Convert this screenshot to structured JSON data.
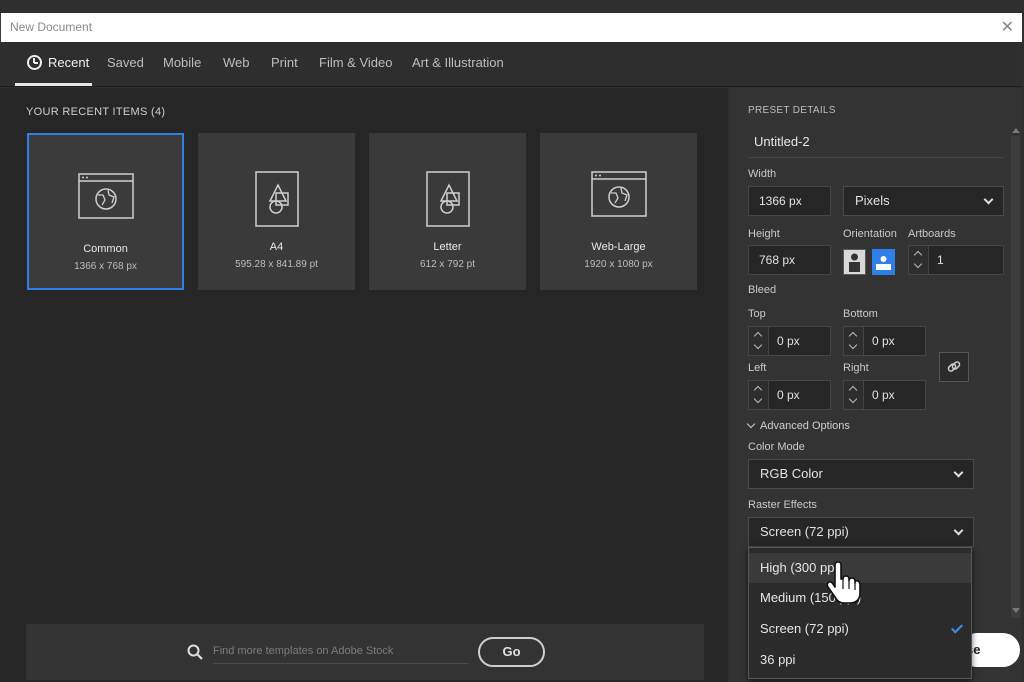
{
  "window": {
    "title": "New Document",
    "close_glyph": "✕"
  },
  "tabs": [
    {
      "label": "Recent",
      "active": true,
      "icon": "clock-icon"
    },
    {
      "label": "Saved"
    },
    {
      "label": "Mobile"
    },
    {
      "label": "Web"
    },
    {
      "label": "Print"
    },
    {
      "label": "Film & Video"
    },
    {
      "label": "Art & Illustration"
    }
  ],
  "recent": {
    "heading": "YOUR RECENT ITEMS",
    "count": "(4)",
    "items": [
      {
        "name": "Common",
        "dimensions": "1366 x 768 px",
        "icon": "web-globe-icon",
        "selected": true
      },
      {
        "name": "A4",
        "dimensions": "595.28 x 841.89 pt",
        "icon": "print-doc-icon"
      },
      {
        "name": "Letter",
        "dimensions": "612 x 792 pt",
        "icon": "print-doc-icon"
      },
      {
        "name": "Web-Large",
        "dimensions": "1920 x 1080 px",
        "icon": "web-globe-icon"
      }
    ]
  },
  "search": {
    "placeholder": "Find more templates on Adobe Stock",
    "go_label": "Go"
  },
  "preset": {
    "heading": "PRESET DETAILS",
    "doc_name": "Untitled-2",
    "width_label": "Width",
    "width_value": "1366 px",
    "units": "Pixels",
    "height_label": "Height",
    "height_value": "768 px",
    "orientation_label": "Orientation",
    "artboards_label": "Artboards",
    "artboards_value": "1",
    "bleed_label": "Bleed",
    "top_label": "Top",
    "top_value": "0 px",
    "bottom_label": "Bottom",
    "bottom_value": "0 px",
    "left_label": "Left",
    "left_value": "0 px",
    "right_label": "Right",
    "right_value": "0 px",
    "advanced_label": "Advanced Options",
    "color_mode_label": "Color Mode",
    "color_mode_value": "RGB Color",
    "raster_label": "Raster Effects",
    "raster_value": "Screen (72 ppi)",
    "create_label": "se"
  },
  "raster_menu": {
    "options": [
      {
        "label": "High (300 ppi)",
        "hover": true
      },
      {
        "label": "Medium (150 ppi)"
      },
      {
        "label": "Screen (72 ppi)",
        "checked": true
      },
      {
        "label": "36 ppi"
      }
    ]
  },
  "colors": {
    "accent": "#2e7fe8",
    "bg": "#262626",
    "panel": "#333333"
  }
}
